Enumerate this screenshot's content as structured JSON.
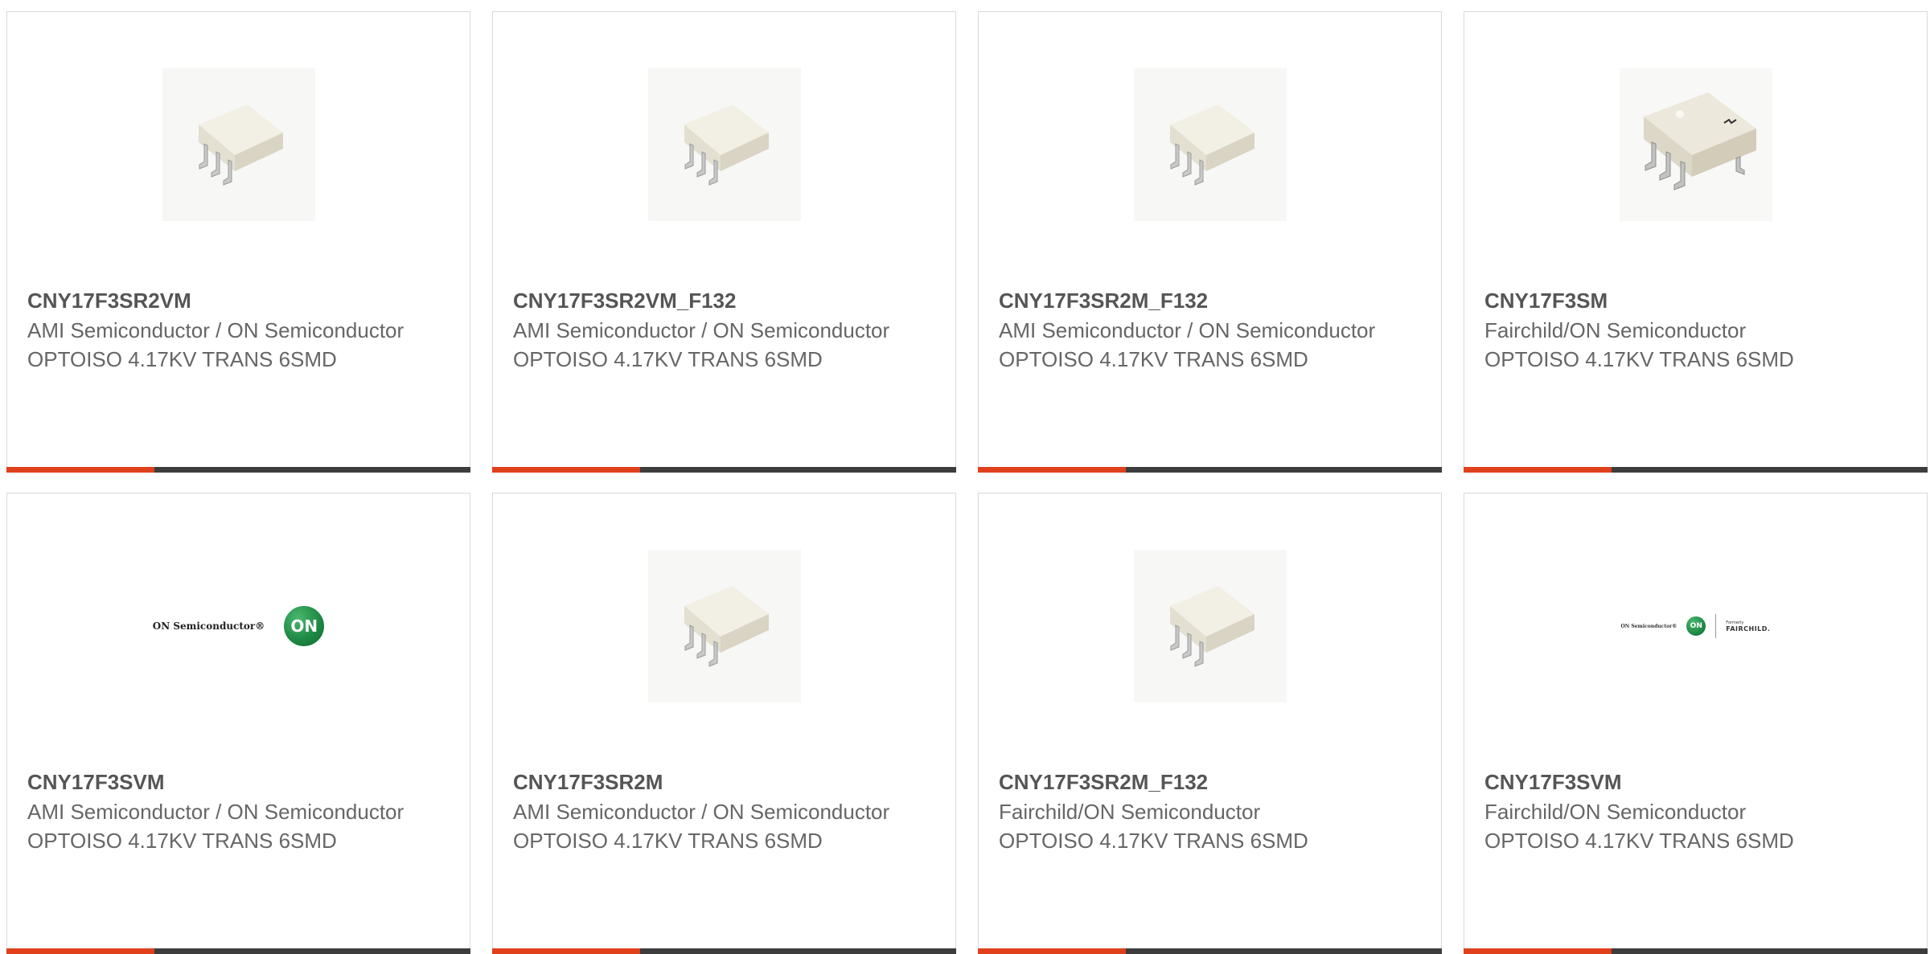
{
  "products": [
    {
      "part_number": "CNY17F3SR2VM",
      "manufacturer": "AMI Semiconductor / ON Semiconductor",
      "description": "OPTOISO 4.17KV TRANS 6SMD",
      "image": "chip-6smd-small"
    },
    {
      "part_number": "CNY17F3SR2VM_F132",
      "manufacturer": "AMI Semiconductor / ON Semiconductor",
      "description": "OPTOISO 4.17KV TRANS 6SMD",
      "image": "chip-6smd-small"
    },
    {
      "part_number": "CNY17F3SR2M_F132",
      "manufacturer": "AMI Semiconductor / ON Semiconductor",
      "description": "OPTOISO 4.17KV TRANS 6SMD",
      "image": "chip-6smd-small"
    },
    {
      "part_number": "CNY17F3SM",
      "manufacturer": "Fairchild/ON Semiconductor",
      "description": "OPTOISO 4.17KV TRANS 6SMD",
      "image": "chip-6smd-large"
    },
    {
      "part_number": "CNY17F3SVM",
      "manufacturer": "AMI Semiconductor / ON Semiconductor",
      "description": "OPTOISO 4.17KV TRANS 6SMD",
      "image": "on-semiconductor-logo",
      "logo_text": "ON Semiconductor®",
      "logo_mark": "ON"
    },
    {
      "part_number": "CNY17F3SR2M",
      "manufacturer": "AMI Semiconductor / ON Semiconductor",
      "description": "OPTOISO 4.17KV TRANS 6SMD",
      "image": "chip-6smd-small"
    },
    {
      "part_number": "CNY17F3SR2M_F132",
      "manufacturer": "Fairchild/ON Semiconductor",
      "description": "OPTOISO 4.17KV TRANS 6SMD",
      "image": "chip-6smd-small"
    },
    {
      "part_number": "CNY17F3SVM",
      "manufacturer": "Fairchild/ON Semiconductor",
      "description": "OPTOISO 4.17KV TRANS 6SMD",
      "image": "on-fairchild-logo",
      "logo_text": "ON Semiconductor®",
      "logo_mark": "ON",
      "logo_formerly": "Formerly",
      "logo_brand": "FAIRCHILD."
    }
  ],
  "colors": {
    "accent": "#e0401c",
    "bar": "#3d3d3d",
    "border": "#d9d9d9",
    "text": "#666666"
  }
}
